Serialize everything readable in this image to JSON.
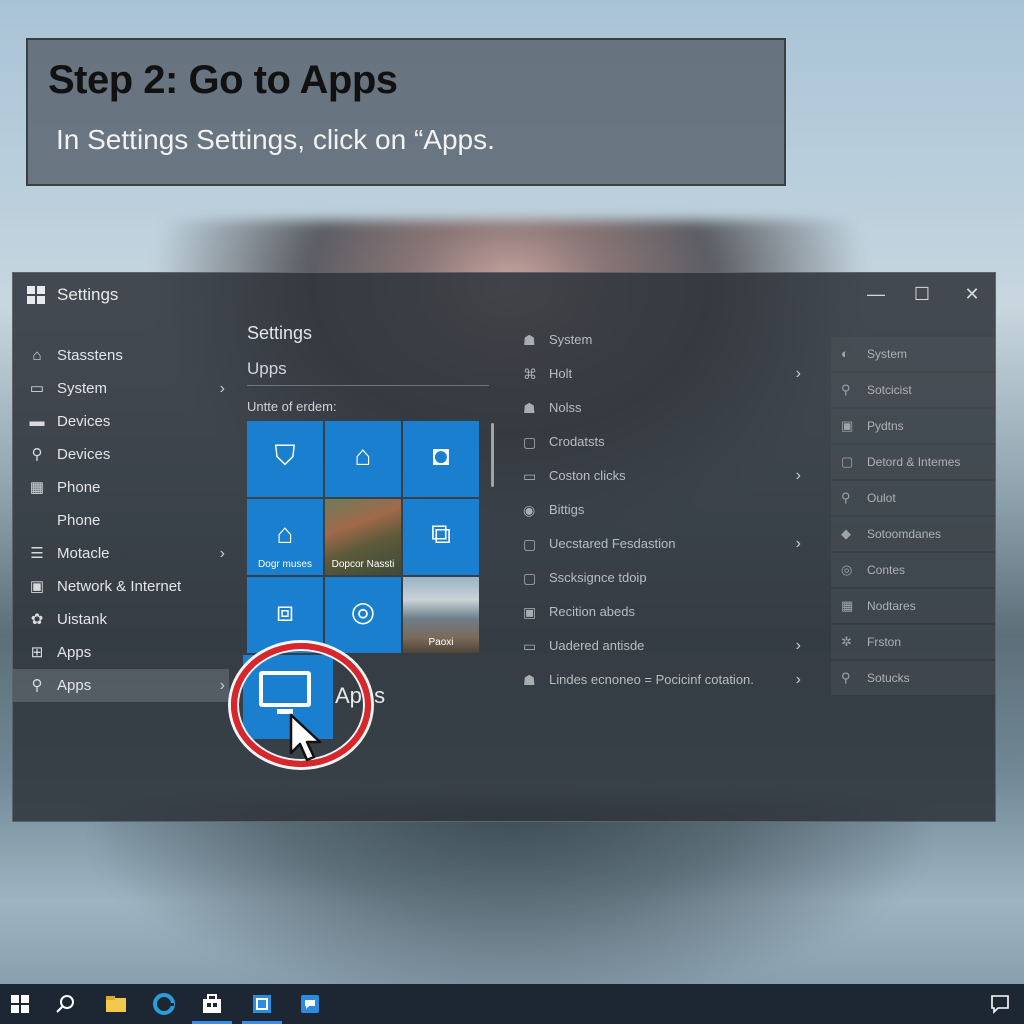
{
  "banner": {
    "title": "Step 2: Go to Apps",
    "instruction": "In Settings Settings, click on “Apps."
  },
  "window": {
    "title": "Settings",
    "controls": {
      "minimize": "—",
      "maximize": "☐",
      "close": "✕"
    }
  },
  "nav": {
    "items": [
      {
        "label": "Stasstens",
        "icon": "⌂",
        "chevron": ""
      },
      {
        "label": "System",
        "icon": "▭",
        "chevron": "›"
      },
      {
        "label": "Devices",
        "icon": "▬",
        "chevron": ""
      },
      {
        "label": "Devices",
        "icon": "⚲",
        "chevron": ""
      },
      {
        "label": "Phone",
        "icon": "▦",
        "chevron": ""
      },
      {
        "label": "Phone",
        "icon": "",
        "chevron": ""
      },
      {
        "label": "Motacle",
        "icon": "☰",
        "chevron": "›"
      },
      {
        "label": "Network & Internet",
        "icon": "▣",
        "chevron": ""
      },
      {
        "label": "Uistank",
        "icon": "✿",
        "chevron": ""
      },
      {
        "label": "Apps",
        "icon": "⊞",
        "chevron": ""
      },
      {
        "label": "Apps",
        "icon": "⚲",
        "chevron": "›"
      }
    ]
  },
  "middle": {
    "title": "Settings",
    "subtitle": "Upps",
    "section_label": "Untte of erdem:",
    "tiles": [
      {
        "icon": "⛉",
        "caption": ""
      },
      {
        "icon": "⌂",
        "caption": ""
      },
      {
        "icon": "◘",
        "caption": ""
      },
      {
        "icon": "⌂",
        "caption": "Dogr muses"
      },
      {
        "icon": "",
        "caption": "Dopcor Nassti"
      },
      {
        "icon": "⧉",
        "caption": ""
      },
      {
        "icon": "⧈",
        "caption": ""
      },
      {
        "icon": "◎",
        "caption": ""
      },
      {
        "icon": "",
        "caption": "Paoxi"
      }
    ],
    "apps_label": "Apps"
  },
  "col2": {
    "rows": [
      {
        "label": "System",
        "icon": "☗",
        "chevron": ""
      },
      {
        "label": "Holt",
        "icon": "⌘",
        "chevron": "›"
      },
      {
        "label": "Nolss",
        "icon": "☗",
        "chevron": ""
      },
      {
        "label": "Crodatsts",
        "icon": "▢",
        "chevron": ""
      },
      {
        "label": "Coston clicks",
        "icon": "▭",
        "chevron": "›"
      },
      {
        "label": "Bittigs",
        "icon": "◉",
        "chevron": ""
      },
      {
        "label": "Uecstared Fesdastion",
        "icon": "▢",
        "chevron": "›"
      },
      {
        "label": "Sscksignce tdoip",
        "icon": "▢",
        "chevron": ""
      },
      {
        "label": "Recition abeds",
        "icon": "▣",
        "chevron": ""
      },
      {
        "label": "Uadered antisde",
        "icon": "▭",
        "chevron": "›"
      },
      {
        "label": "Lindes ecnoneo = Pocicinf cotation.",
        "icon": "☗",
        "chevron": "›"
      }
    ]
  },
  "col3": {
    "rows": [
      {
        "label": "System",
        "icon": "◐"
      },
      {
        "label": "Sotcicist",
        "icon": "⚲"
      },
      {
        "label": "Pydtns",
        "icon": "▣"
      },
      {
        "label": "Detord & Intemes",
        "icon": "▢"
      },
      {
        "label": "Oulot",
        "icon": "⚲"
      },
      {
        "label": "Sotoomdanes",
        "icon": "◆"
      },
      {
        "label": "Contes",
        "icon": "◎"
      },
      {
        "label": "Nodtares",
        "icon": "▦"
      },
      {
        "label": "Frston",
        "icon": "✲"
      },
      {
        "label": "Sotucks",
        "icon": "⚲"
      }
    ]
  },
  "colors": {
    "accent": "#1b7fd0",
    "highlight": "#d8262a",
    "taskbar": "#1c2733"
  }
}
